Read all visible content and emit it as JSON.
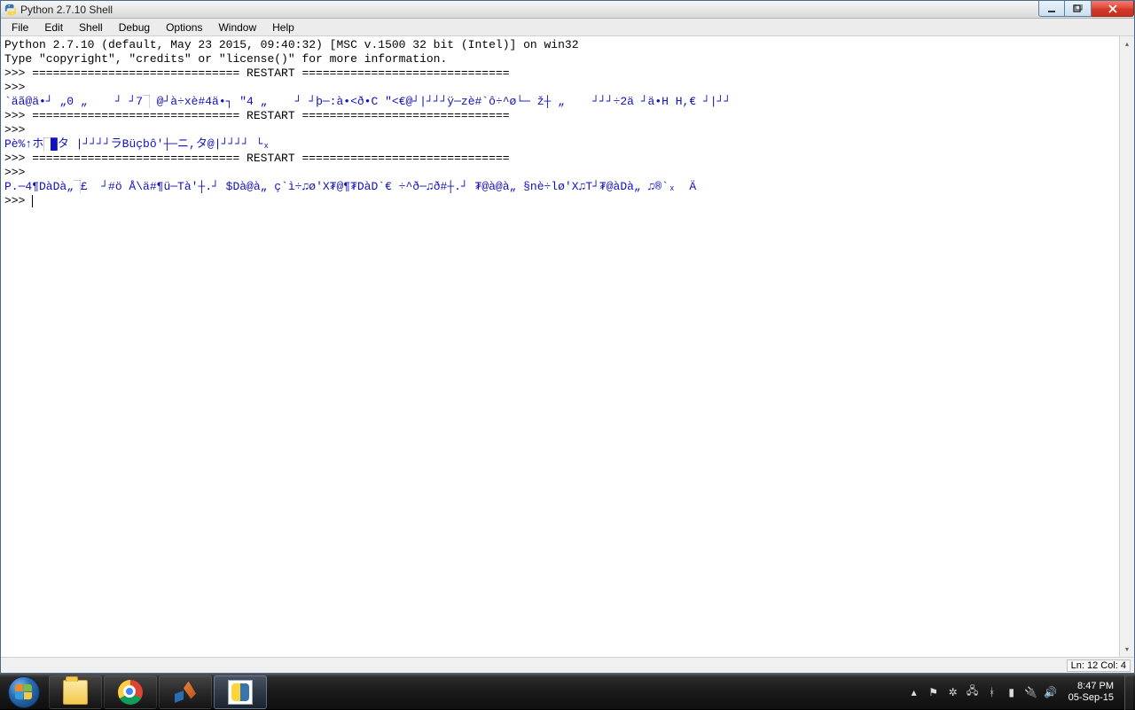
{
  "window": {
    "title": "Python 2.7.10 Shell"
  },
  "menu": {
    "items": [
      "File",
      "Edit",
      "Shell",
      "Debug",
      "Options",
      "Window",
      "Help"
    ]
  },
  "shell": {
    "banner1": "Python 2.7.10 (default, May 23 2015, 09:40:32) [MSC v.1500 32 bit (Intel)] on win32",
    "banner2": "Type \"copyright\", \"credits\" or \"license()\" for more information.",
    "restart_line": ">>> ============================== RESTART ==============================",
    "prompt": ">>> ",
    "out1_a": "`äã@ä•┘ „0 „    ┘ ┘7",
    "out1_b": " @┘à÷xè#4ä•┐ ″4 „    ┘ ┘þ─:à•<ð•C ″<€@┘|┘┘┘ÿ─zè#`ô÷^ø└─ ž┼ „    ┘┘┘÷2ä ┘ä•H H,€ ┘|┘┘",
    "out2_a": "Pè%↑ホ",
    "out2_b_hl1": "█",
    "out2_c": "█",
    "out2_d": "タ |┘┘┘┘ラBüçbô'┼─ニ,タ@|┘┘┘┘ └ₓ",
    "out3_a": "P.─4¶DàDà„",
    "out3_b_hl": "█",
    "out3_c": "£  ┘#ö Å\\ä#¶ü─Tà'┼.┘ $Dà@à„ ç`ì÷♫ø'X₮@¶₮DàD`€ ÷^ð─♫ð#┼.┘ ₮@à@à„ §nè÷lø'X♫T┘₮@àDà„ ♫®`ₓ  Ä"
  },
  "status": {
    "text": "Ln: 12 Col: 4"
  },
  "taskbar": {
    "apps": [
      "start",
      "explorer",
      "chrome",
      "matlab",
      "idle"
    ],
    "tray_up": "▴",
    "clock_time": "8:47 PM",
    "clock_date": "05-Sep-15"
  }
}
